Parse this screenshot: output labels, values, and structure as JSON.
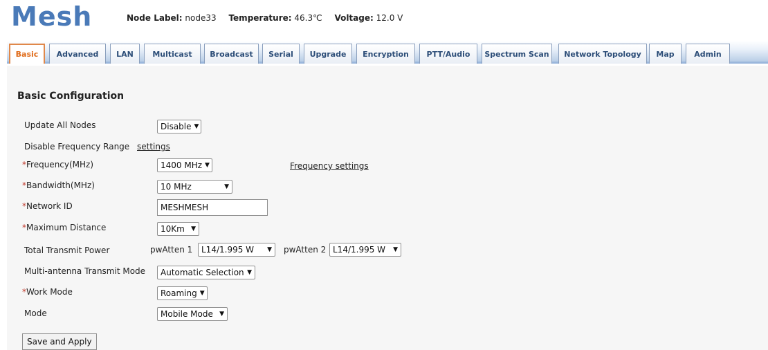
{
  "header": {
    "logo": "Mesh",
    "node_label_key": "Node Label:",
    "node_label_value": "node33",
    "temperature_key": "Temperature:",
    "temperature_value": "46.3℃",
    "voltage_key": "Voltage:",
    "voltage_value": "12.0 V"
  },
  "tabs": [
    {
      "label": "Basic",
      "active": true
    },
    {
      "label": "Advanced"
    },
    {
      "label": "LAN"
    },
    {
      "label": "Multicast"
    },
    {
      "label": "Broadcast"
    },
    {
      "label": "Serial"
    },
    {
      "label": "Upgrade"
    },
    {
      "label": "Encryption"
    },
    {
      "label": "PTT/Audio"
    },
    {
      "label": "Spectrum Scan"
    },
    {
      "label": "Network Topology"
    },
    {
      "label": "Map"
    },
    {
      "label": "Admin"
    }
  ],
  "form": {
    "title": "Basic Configuration",
    "update_all_nodes": {
      "label": "Update All Nodes",
      "value": "Disable"
    },
    "disable_freq_range": {
      "label": "Disable Frequency Range",
      "link": "settings"
    },
    "frequency": {
      "required": "*",
      "label": "Frequency(MHz)",
      "value": "1400 MHz",
      "link": "Frequency settings"
    },
    "bandwidth": {
      "required": "*",
      "label": "Bandwidth(MHz)",
      "value": "10 MHz"
    },
    "network_id": {
      "required": "*",
      "label": "Network ID",
      "value": "MESHMESH"
    },
    "max_distance": {
      "required": "*",
      "label": "Maximum Distance",
      "value": "10Km"
    },
    "tx_power": {
      "label": "Total Transmit Power",
      "atten1_label": "pwAtten 1",
      "atten1_value": "L14/1.995 W",
      "atten2_label": "pwAtten 2",
      "atten2_value": "L14/1.995 W"
    },
    "multi_antenna": {
      "label": "Multi-antenna Transmit Mode",
      "value": "Automatic Selection"
    },
    "work_mode": {
      "required": "*",
      "label": "Work Mode",
      "value": "Roaming"
    },
    "mode": {
      "label": "Mode",
      "value": "Mobile Mode"
    },
    "save_label": "Save and Apply"
  },
  "colors": {
    "logo": "#4a7ab8",
    "active_tab_text": "#e06c1b",
    "tab_text": "#2c4d78",
    "required_marker": "#c0392b"
  }
}
